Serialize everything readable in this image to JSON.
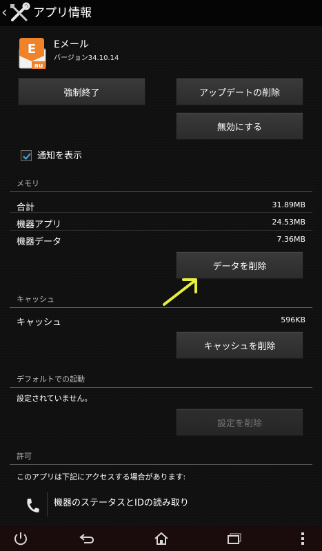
{
  "action_bar": {
    "title": "アプリ情報",
    "back_icon": "chevron-left-icon",
    "app_settings_icon": "tools-icon"
  },
  "app": {
    "name": "Eメール",
    "version": "バージョン34.10.14",
    "icon": "email-app-icon",
    "icon_letter": "E",
    "icon_badge": "au",
    "icon_color": "#f0822a"
  },
  "buttons": {
    "force_stop": "強制終了",
    "uninstall_updates": "アップデートの削除",
    "disable": "無効にする",
    "clear_data": "データを削除",
    "clear_cache": "キャッシュを削除",
    "clear_defaults": "設定を削除"
  },
  "notifications": {
    "label": "通知を表示",
    "checked": true
  },
  "memory": {
    "header": "メモリ",
    "rows": [
      {
        "label": "合計",
        "value": "31.89MB"
      },
      {
        "label": "機器アプリ",
        "value": "24.53MB"
      },
      {
        "label": "機器データ",
        "value": "7.36MB"
      }
    ]
  },
  "cache": {
    "header": "キャッシュ",
    "label": "キャッシュ",
    "value": "596KB"
  },
  "defaults": {
    "header": "デフォルトでの起動",
    "text": "設定されていません。"
  },
  "permissions": {
    "header": "許可",
    "text": "このアプリは下記にアクセスする場合があります:",
    "items": [
      {
        "label": "機器のステータスとIDの読み取り",
        "icon": "phone-icon"
      }
    ]
  },
  "annotation": {
    "arrow_color": "#e6f03c"
  },
  "nav_bar": {
    "icons": [
      "power-icon",
      "back-icon",
      "home-icon",
      "recent-apps-icon",
      "overflow-menu-icon"
    ]
  }
}
